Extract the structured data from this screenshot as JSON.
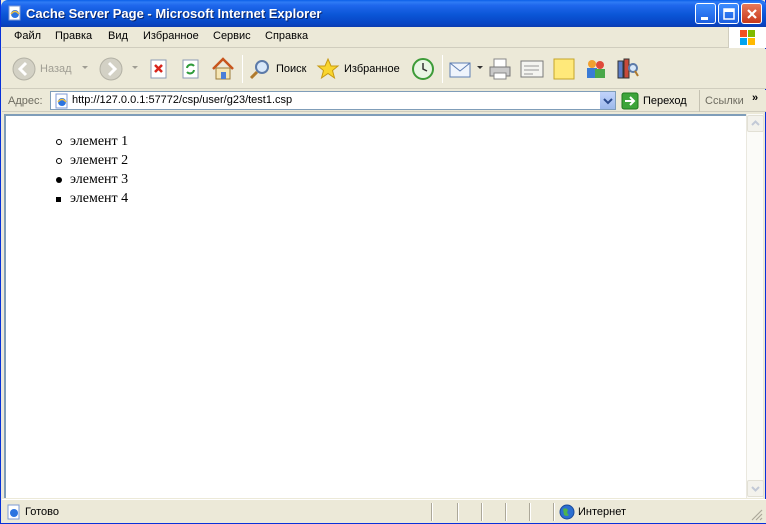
{
  "window": {
    "title": "Cache Server Page - Microsoft Internet Explorer"
  },
  "menu": {
    "items": [
      "Файл",
      "Правка",
      "Вид",
      "Избранное",
      "Сервис",
      "Справка"
    ]
  },
  "toolbar": {
    "back_label": "Назад",
    "search_label": "Поиск",
    "favorites_label": "Избранное"
  },
  "address": {
    "label": "Адрес:",
    "url": "http://127.0.0.1:57772/csp/user/g23/test1.csp",
    "go_label": "Переход",
    "links_label": "Ссылки",
    "more": "»"
  },
  "page": {
    "items": [
      {
        "text": "элемент 1",
        "bullet": "circle"
      },
      {
        "text": "элемент 2",
        "bullet": "circle"
      },
      {
        "text": "элемент 3",
        "bullet": "disc"
      },
      {
        "text": "элемент 4",
        "bullet": "square"
      }
    ]
  },
  "status": {
    "text": "Готово",
    "zone": "Интернет"
  },
  "colors": {
    "titlebar": "#0A55D6",
    "chrome": "#ECE9D8",
    "close": "#C8391B"
  }
}
